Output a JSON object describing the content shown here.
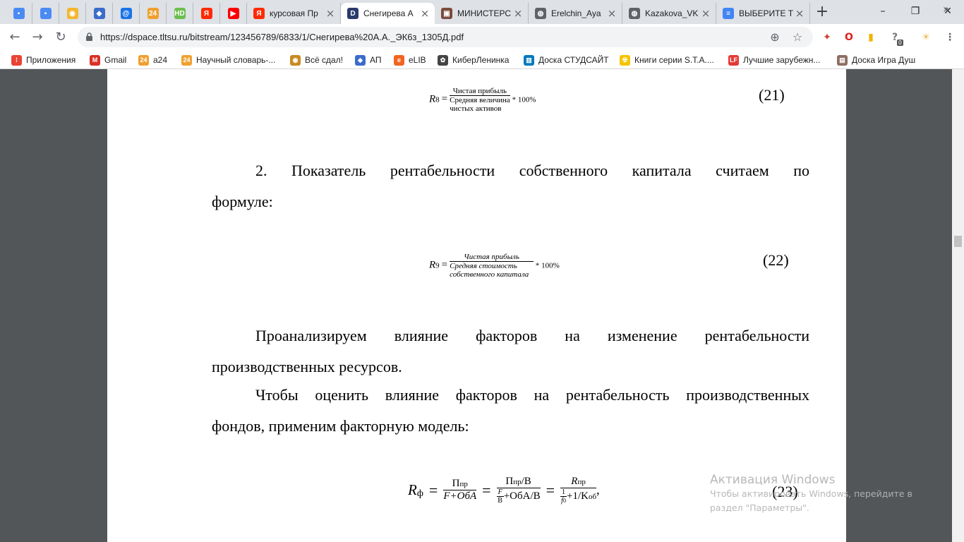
{
  "tabs": [
    {
      "title": "",
      "icon": "chat-icon",
      "color": "#4a8af4",
      "glyph": "▪",
      "pinned": true
    },
    {
      "title": "",
      "icon": "chat-icon",
      "color": "#4a8af4",
      "glyph": "▪",
      "pinned": true
    },
    {
      "title": "",
      "icon": "owl-icon",
      "color": "#f2b631",
      "glyph": "◉",
      "pinned": true
    },
    {
      "title": "",
      "icon": "shield-icon",
      "color": "#3b6cc9",
      "glyph": "◆",
      "pinned": true
    },
    {
      "title": "",
      "icon": "at-icon",
      "color": "#1a73e8",
      "glyph": "@",
      "pinned": true
    },
    {
      "title": "",
      "icon": "a24-icon",
      "color": "#f0a030",
      "glyph": "24",
      "pinned": true
    },
    {
      "title": "",
      "icon": "hd-icon",
      "color": "#6bbf4e",
      "glyph": "HD",
      "pinned": true
    },
    {
      "title": "",
      "icon": "yandex-icon",
      "color": "#ff2a00",
      "glyph": "Я",
      "pinned": true
    },
    {
      "title": "",
      "icon": "youtube-icon",
      "color": "#ff0000",
      "glyph": "▶",
      "pinned": true
    },
    {
      "title": "курсовая Пр",
      "icon": "yandex-icon",
      "color": "#ff2a00",
      "glyph": "Я",
      "pinned": false
    },
    {
      "title": "Снегирева А",
      "icon": "dspace-icon",
      "color": "#2b3b6b",
      "glyph": "D",
      "pinned": false,
      "active": true
    },
    {
      "title": "МИНИСТЕРС",
      "icon": "document-icon",
      "color": "#7a4b3b",
      "glyph": "▣",
      "pinned": false
    },
    {
      "title": "Erelchin_Aya",
      "icon": "globe-icon",
      "color": "#5f6368",
      "glyph": "◍",
      "pinned": false
    },
    {
      "title": "Kazakova_VK",
      "icon": "globe-icon",
      "color": "#5f6368",
      "glyph": "◍",
      "pinned": false
    },
    {
      "title": "ВЫБЕРИТЕ Т",
      "icon": "docs-icon",
      "color": "#4285f4",
      "glyph": "≡",
      "pinned": false
    }
  ],
  "window": {
    "minimize": "–",
    "maximize": "❐",
    "close": "✕"
  },
  "toolbar": {
    "url": "https://dspace.tltsu.ru/bitstream/123456789/6833/1/Снегирева%20А.А._ЭК6з_1305Д.pdf",
    "back": "←",
    "forward": "→",
    "reload": "↻",
    "zoom": "⊕",
    "star": "☆"
  },
  "extensions": [
    {
      "icon": "colorful-extension-icon",
      "glyph": "✦",
      "color": "#d23f31"
    },
    {
      "icon": "opera-icon",
      "glyph": "O",
      "color": "#e0201b"
    },
    {
      "icon": "bookmark-extension-icon",
      "glyph": "▮",
      "color": "#f0b400"
    },
    {
      "icon": "question-badge-icon",
      "glyph": "?",
      "color": "#777777",
      "badge": "0"
    },
    {
      "icon": "sun-icon",
      "glyph": "☀",
      "color": "#e8c060"
    },
    {
      "icon": "menu-icon",
      "glyph": "⋮",
      "color": "#5f6368"
    }
  ],
  "bookmarks": [
    {
      "label": "Приложения",
      "icon": "apps-icon",
      "color": "#ea4335",
      "glyph": "⁞"
    },
    {
      "label": "Gmail",
      "icon": "gmail-icon",
      "color": "#d93025",
      "glyph": "M"
    },
    {
      "label": "a24",
      "icon": "a24-icon",
      "color": "#f0a030",
      "glyph": "24"
    },
    {
      "label": "Научный словарь-...",
      "icon": "a24-icon",
      "color": "#f0a030",
      "glyph": "24"
    },
    {
      "label": "Всё сдал!",
      "icon": "owl-icon",
      "color": "#c88a20",
      "glyph": "◉"
    },
    {
      "label": "АП",
      "icon": "shield-icon",
      "color": "#3b6cc9",
      "glyph": "◆"
    },
    {
      "label": "eLIB",
      "icon": "elib-icon",
      "color": "#f26522",
      "glyph": "e"
    },
    {
      "label": "КиберЛенинка",
      "icon": "cyberleninka-icon",
      "color": "#444444",
      "glyph": "✿"
    },
    {
      "label": "Доска СТУДСАЙТ",
      "icon": "trello-icon",
      "color": "#0079bf",
      "glyph": "▥"
    },
    {
      "label": "Книги серии S.T.A....",
      "icon": "radiation-icon",
      "color": "#f5c400",
      "glyph": "☢"
    },
    {
      "label": "Лучшие зарубежн...",
      "icon": "lf-icon",
      "color": "#e53935",
      "glyph": "LF"
    },
    {
      "label": "Доска Игра Душ",
      "icon": "board-icon",
      "color": "#8d6e63",
      "glyph": "▤"
    }
  ],
  "bookmarks_more": "»",
  "document": {
    "formula21": {
      "lhs": "R",
      "lhs_sub": "8",
      "equals": "=",
      "numerator": "Чистая прибыль",
      "denominator_1": "Средняя величина",
      "denominator_2": "чистых активов",
      "suffix": "* 100%",
      "number": "(21)"
    },
    "para1_line1": "2. Показатель рентабельности собственного капитала считаем по",
    "para1_line2": "формуле:",
    "formula22": {
      "lhs": "R",
      "lhs_sub": "9",
      "equals": "=",
      "numerator": "Чистая прибыль",
      "denominator_1": "Средняя стоимость",
      "denominator_2": "собственного капитала",
      "suffix": "* 100%",
      "number": "(22)"
    },
    "para2_line1": "Проанализируем влияние факторов на изменение рентабельности",
    "para2_line2": "производственных ресурсов.",
    "para3_line1": "Чтобы оценить влияние факторов на рентабельность производственных",
    "para3_line2": "фондов, применим факторную модель:",
    "formula23": {
      "lhs": "R",
      "lhs_sub": "ф",
      "f1_num": "П",
      "f1_num_sub": "пр",
      "f1_den": "F+ОбА",
      "f2_num": "П",
      "f2_num_sub": "пр",
      "f2_num_tail": "/В",
      "f2_den_frac_num": "F",
      "f2_den_frac_den": "В",
      "f2_den_tail": "+ОбА/В",
      "f3_num": "R",
      "f3_num_sub": "пр",
      "f3_den_frac_num": "1",
      "f3_den_frac_den": "f",
      "f3_den_frac_den_sub": "0",
      "f3_den_tail": "+1/K",
      "f3_den_tail_sub": "об",
      "equals": "=",
      "trail": ",",
      "number": "(23)"
    }
  },
  "windows_activation": {
    "title": "Активация Windows",
    "line1": "Чтобы активировать Windows, перейдите в",
    "line2": "раздел \"Параметры\"."
  }
}
